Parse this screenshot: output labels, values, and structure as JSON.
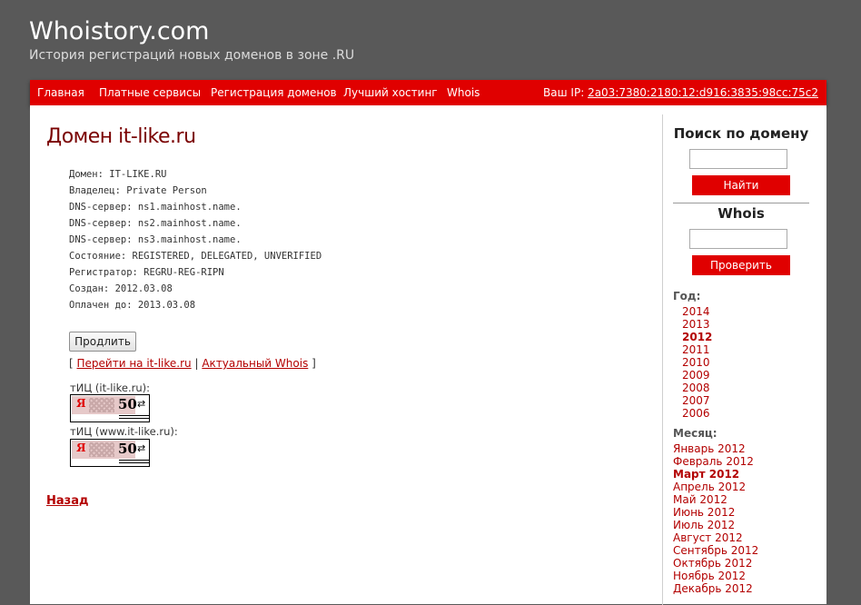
{
  "site": {
    "title": "Whoistory.com",
    "subtitle": "История регистраций новых доменов в зоне .RU"
  },
  "nav": {
    "items": [
      {
        "label": "Главная"
      },
      {
        "label": "Платные сервисы"
      },
      {
        "label": "Регистрация доменов"
      },
      {
        "label": "Лучший хостинг"
      },
      {
        "label": "Whois"
      }
    ],
    "ip_label": "Ваш IP:",
    "ip_value": "2a03:7380:2180:12:d916:3835:98cc:75c2"
  },
  "main": {
    "title": "Домен it-like.ru",
    "whois_lines": [
      "Домен: IT-LIKE.RU",
      "Владелец: Private Person",
      "DNS-сервер: ns1.mainhost.name.",
      "DNS-сервер: ns2.mainhost.name.",
      "DNS-сервер: ns3.mainhost.name.",
      "Состояние: REGISTERED, DELEGATED, UNVERIFIED",
      "Регистратор: REGRU-REG-RIPN",
      "Создан: 2012.03.08",
      "Оплачен до: 2013.03.08"
    ],
    "extend_button": "Продлить",
    "link_open_bracket": "[",
    "link_goto": "Перейти на it-like.ru",
    "link_separator": "|",
    "link_actual_whois": "Актуальный Whois",
    "link_close_bracket": "]",
    "tic": [
      {
        "label": "тИЦ (it-like.ru):",
        "value": "50",
        "logo_letter": "Я"
      },
      {
        "label": "тИЦ (www.it-like.ru):",
        "value": "50",
        "logo_letter": "Я"
      }
    ],
    "back_link": "Назад"
  },
  "sidebar": {
    "search_heading": "Поиск по домену",
    "search_button": "Найти",
    "whois_heading": "Whois",
    "whois_button": "Проверить",
    "year_label": "Год:",
    "years": [
      {
        "label": "2014"
      },
      {
        "label": "2013"
      },
      {
        "label": "2012",
        "active": true
      },
      {
        "label": "2011"
      },
      {
        "label": "2010"
      },
      {
        "label": "2009"
      },
      {
        "label": "2008"
      },
      {
        "label": "2007"
      },
      {
        "label": "2006"
      }
    ],
    "month_label": "Месяц:",
    "months": [
      {
        "label": "Январь 2012"
      },
      {
        "label": "Февраль 2012"
      },
      {
        "label": "Март 2012",
        "active": true
      },
      {
        "label": "Апрель 2012"
      },
      {
        "label": "Май 2012"
      },
      {
        "label": "Июнь 2012"
      },
      {
        "label": "Июль 2012"
      },
      {
        "label": "Август 2012"
      },
      {
        "label": "Сентябрь 2012"
      },
      {
        "label": "Октябрь 2012"
      },
      {
        "label": "Ноябрь 2012"
      },
      {
        "label": "Декабрь 2012"
      }
    ]
  },
  "colors": {
    "accent_red": "#e00000",
    "link_red": "#b30000",
    "title_dark_red": "#7a0000",
    "page_background": "#595959"
  }
}
